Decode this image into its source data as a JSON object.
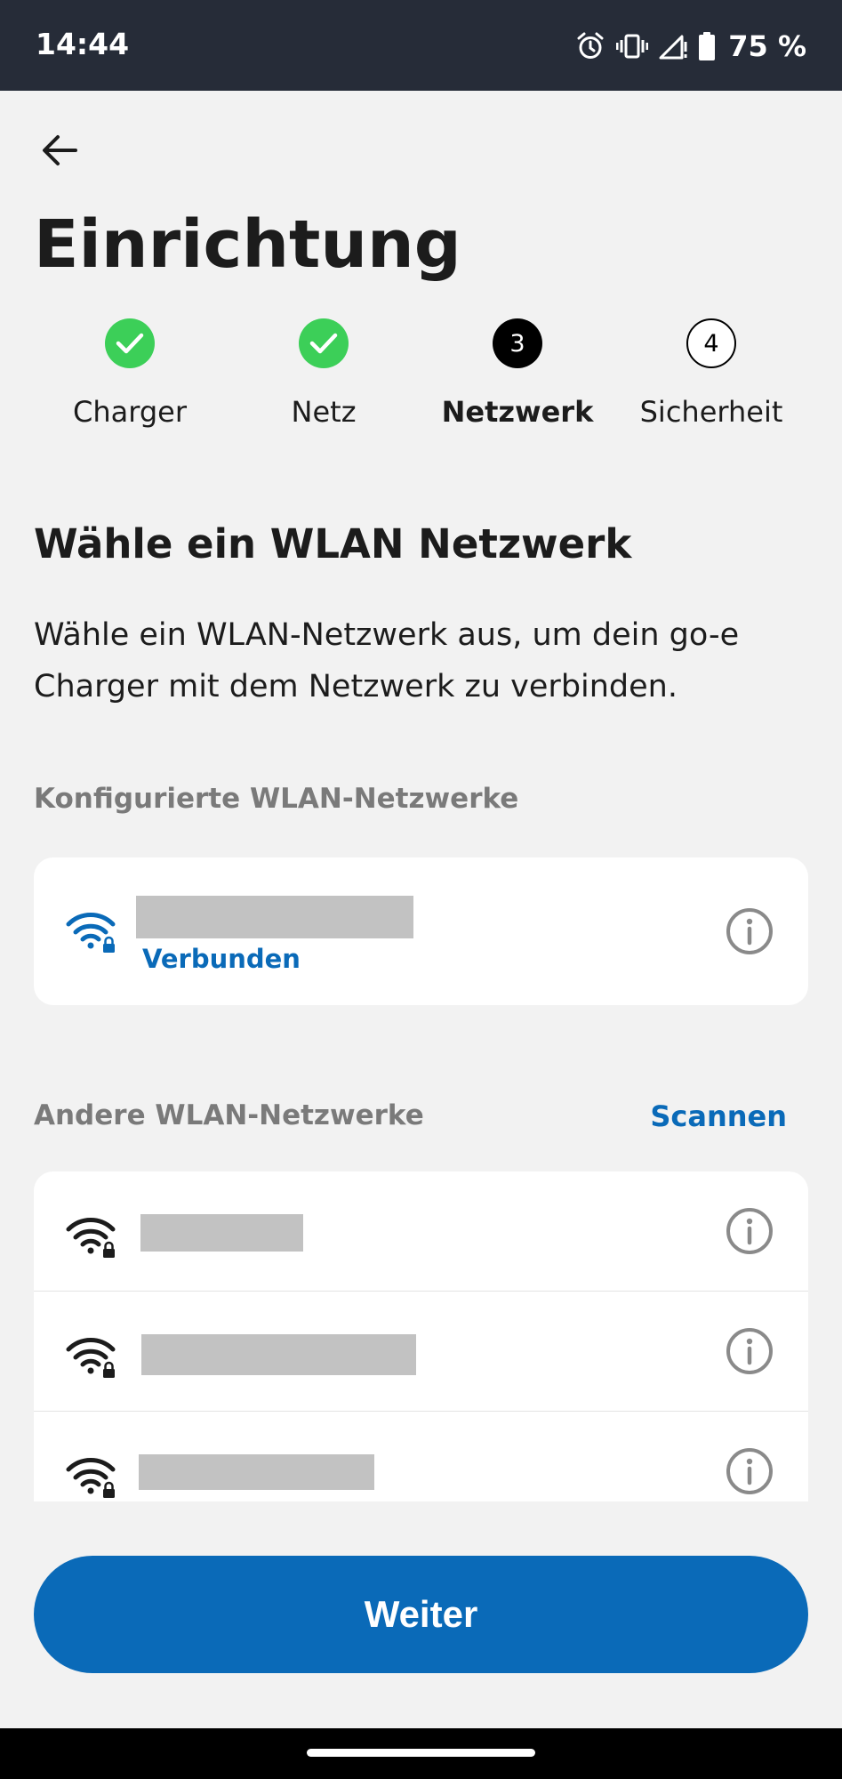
{
  "status_bar": {
    "time": "14:44",
    "battery": "75 %",
    "icons": [
      "alarm-icon",
      "vibrate-icon",
      "signal-icon",
      "battery-icon"
    ]
  },
  "header": {
    "back_icon": "arrow-left-icon",
    "title": "Einrichtung"
  },
  "stepper": {
    "steps": [
      {
        "label": "Charger",
        "state": "done"
      },
      {
        "label": "Netz",
        "state": "done"
      },
      {
        "label": "Netzwerk",
        "number": "3",
        "state": "active"
      },
      {
        "label": "Sicherheit",
        "number": "4",
        "state": "todo"
      }
    ]
  },
  "content": {
    "heading": "Wähle ein WLAN Netzwerk",
    "description": "Wähle ein WLAN-Netzwerk aus, um dein go-e Charger mit dem Netzwerk zu verbinden."
  },
  "configured": {
    "label": "Konfigurierte WLAN-Netzwerke",
    "networks": [
      {
        "status": "Verbunden",
        "icon": "wifi-lock-icon"
      }
    ]
  },
  "other": {
    "label": "Andere WLAN-Netzwerke",
    "scan_label": "Scannen",
    "networks": [
      {
        "icon": "wifi-lock-icon"
      },
      {
        "icon": "wifi-lock-icon"
      },
      {
        "icon": "wifi-lock-icon"
      }
    ]
  },
  "footer": {
    "next_label": "Weiter"
  },
  "colors": {
    "accent": "#0a6ab8",
    "success": "#3ccf58",
    "status_bar": "#262c38"
  }
}
